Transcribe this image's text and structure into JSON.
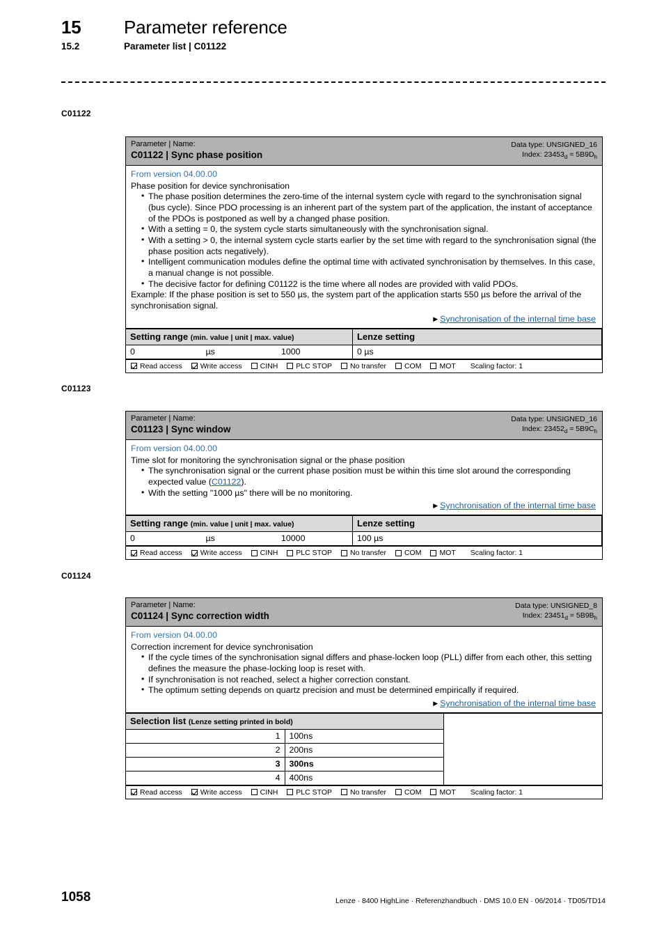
{
  "header": {
    "chapter_number": "15",
    "chapter_title": "Parameter reference",
    "section_number": "15.2",
    "section_title": "Parameter list | C01122"
  },
  "colors": {
    "head_gray": "#b2b2b2",
    "subhead_gray": "#d9d9d9",
    "link_blue": "#1f5fa8",
    "version_blue": "#2e74b5"
  },
  "access_labels": {
    "read": "Read access",
    "write": "Write access",
    "cinh": "CINH",
    "plc_stop": "PLC STOP",
    "no_transfer": "No transfer",
    "com": "COM",
    "mot": "MOT",
    "scaling": "Scaling factor: 1"
  },
  "common": {
    "param_caption": "Parameter | Name:",
    "setting_range_label": "Setting range",
    "setting_range_note": "(min. value | unit | max. value)",
    "lenze_setting_label": "Lenze setting",
    "link_label": "Synchronisation of the internal time base"
  },
  "blocks": [
    {
      "margin_label": "C01122",
      "title": "C01122 | Sync phase position",
      "data_type": "Data type: UNSIGNED_16",
      "index_prefix": "Index: ",
      "index_dec": "23453",
      "index_dec_sub": "d",
      "index_eq": " = ",
      "index_hex": "5B9D",
      "index_hex_sub": "h",
      "from_version": "From version 04.00.00",
      "intro": "Phase position for device synchronisation",
      "bullets": [
        "The phase position determines the zero-time of the internal system cycle with regard to the synchronisation signal (bus cycle). Since PDO processing is an inherent part of the system part of the application, the instant of acceptance of the PDOs is postponed as well by a changed phase position.",
        "With a setting = 0, the system cycle starts simultaneously with the synchronisation signal.",
        "With a setting > 0, the internal system cycle starts earlier by the set time with regard to the synchronisation signal (the phase position acts negatively).",
        "Intelligent communication modules define the optimal time with activated synchronisation by themselves. In this case, a manual change is not possible.",
        "The decisive factor for defining C01122 is the time where all nodes are provided with valid PDOs."
      ],
      "outro": "Example: If the phase position is set to 550 µs, the system part of the application starts 550 µs before the arrival of the synchronisation signal.",
      "setting_range": {
        "min": "0",
        "unit": "µs",
        "max": "1000",
        "lenze_value": "0 µs"
      }
    },
    {
      "margin_label": "C01123",
      "title": "C01123 | Sync window",
      "data_type": "Data type: UNSIGNED_16",
      "index_prefix": "Index: ",
      "index_dec": "23452",
      "index_dec_sub": "d",
      "index_eq": " = ",
      "index_hex": "5B9C",
      "index_hex_sub": "h",
      "from_version": "From version 04.00.00",
      "intro": "Time slot for monitoring the synchronisation signal or the phase position",
      "bullet_1_pre": "The synchronisation signal or the current phase position must be within this time slot around the corresponding expected value (",
      "bullet_1_link": "C01122",
      "bullet_1_post": ").",
      "bullet_2": "With the setting \"1000 µs\" there will be no monitoring.",
      "setting_range": {
        "min": "0",
        "unit": "µs",
        "max": "10000",
        "lenze_value": "100 µs"
      }
    },
    {
      "margin_label": "C01124",
      "title": "C01124 | Sync correction width",
      "data_type": "Data type: UNSIGNED_8",
      "index_prefix": "Index: ",
      "index_dec": "23451",
      "index_dec_sub": "d",
      "index_eq": " = ",
      "index_hex": "5B9B",
      "index_hex_sub": "h",
      "from_version": "From version 04.00.00",
      "intro": "Correction increment for device synchronisation",
      "bullets": [
        "If the cycle times of the synchronisation signal differs and phase-locken loop (PLL) differ from each other, this setting defines the measure the phase-locking loop is reset with.",
        "If synchronisation is not reached, select a higher correction constant.",
        "The optimum setting depends on quartz precision and must be determined empirically if required."
      ],
      "selection_list": {
        "label": "Selection list",
        "note": "(Lenze setting printed in bold)",
        "rows": [
          {
            "code": "1",
            "text": "100ns",
            "bold": false
          },
          {
            "code": "2",
            "text": "200ns",
            "bold": false
          },
          {
            "code": "3",
            "text": "300ns",
            "bold": true
          },
          {
            "code": "4",
            "text": "400ns",
            "bold": false
          }
        ]
      }
    }
  ],
  "footer": {
    "page_number": "1058",
    "imprint": "Lenze · 8400 HighLine · Referenzhandbuch · DMS 10.0 EN · 06/2014 · TD05/TD14"
  }
}
